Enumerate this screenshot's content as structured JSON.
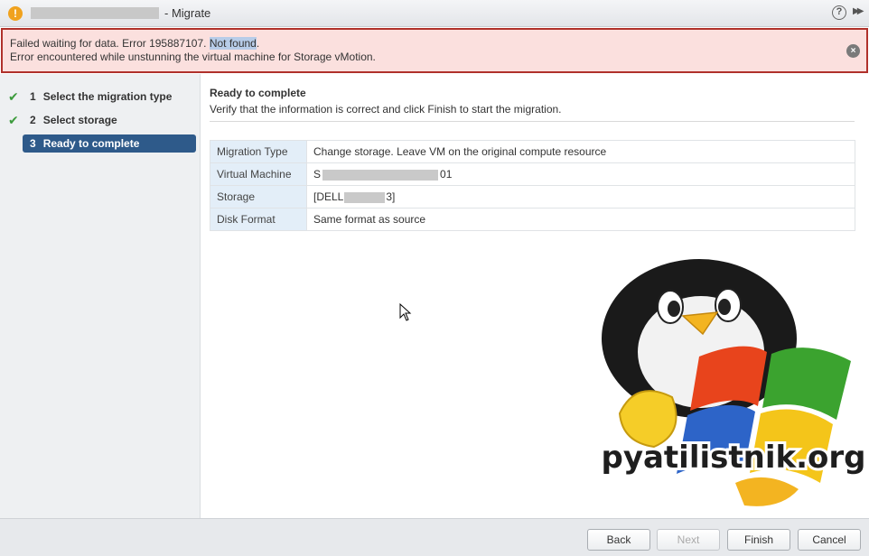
{
  "window": {
    "title": "- Migrate",
    "warning_icon": "!",
    "help_icon": "?",
    "expand_icon": "▶▶"
  },
  "error": {
    "line1_prefix": "Failed waiting for data. Error 195887107. ",
    "line1_highlight": "Not found",
    "line1_suffix": ".",
    "line2": "Error encountered while unstunning the virtual machine for Storage vMotion.",
    "close_icon": "×"
  },
  "nav": {
    "items": [
      {
        "num": "1",
        "label": "Select the migration type",
        "state": "done"
      },
      {
        "num": "2",
        "label": "Select storage",
        "state": "done"
      },
      {
        "num": "3",
        "label": "Ready to complete",
        "state": "active"
      }
    ],
    "check_glyph": "✔"
  },
  "content": {
    "title": "Ready to complete",
    "subtitle": "Verify that the information is correct and click Finish to start the migration.",
    "rows": [
      {
        "label": "Migration Type",
        "value": "Change storage. Leave VM on the original compute resource"
      },
      {
        "label": "Virtual Machine",
        "value_prefix": "S",
        "value_suffix": "01"
      },
      {
        "label": "Storage",
        "value_prefix": "[DELL",
        "value_suffix": "3]"
      },
      {
        "label": "Disk Format",
        "value": "Same format as source"
      }
    ]
  },
  "watermark": {
    "text": "pyatilistnik.org"
  },
  "footer": {
    "back": "Back",
    "next": "Next",
    "finish": "Finish",
    "cancel": "Cancel"
  },
  "colors": {
    "error_border": "#b0312b",
    "error_bg": "#fbe0de",
    "active_nav": "#2e5a8a",
    "check": "#3c9b3c"
  }
}
